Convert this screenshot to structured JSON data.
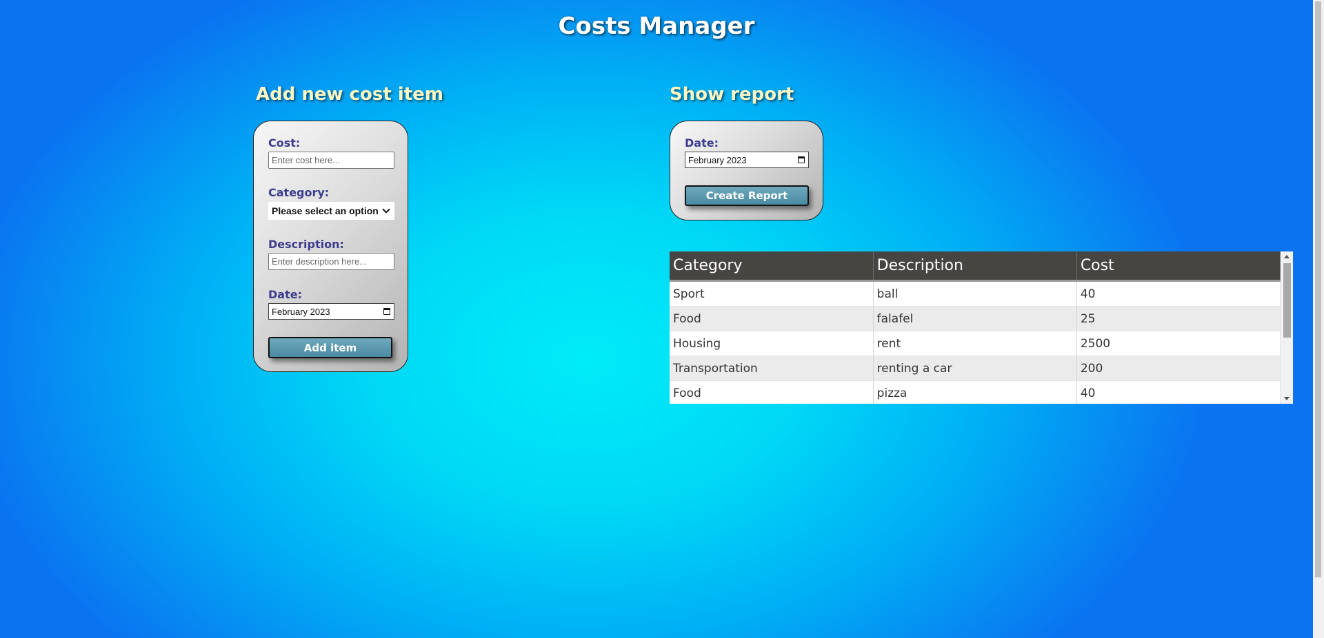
{
  "app": {
    "title": "Costs Manager"
  },
  "add_section": {
    "title": "Add new cost item",
    "cost": {
      "label": "Cost:",
      "placeholder": "Enter cost here..."
    },
    "category": {
      "label": "Category:",
      "selected": "Please select an option"
    },
    "description": {
      "label": "Description:",
      "placeholder": "Enter description here..."
    },
    "date": {
      "label": "Date:",
      "value": "February 2023",
      "icon": "calendar-icon"
    },
    "button": "Add item"
  },
  "report_section": {
    "title": "Show report",
    "date": {
      "label": "Date:",
      "value": "February 2023",
      "icon": "calendar-icon"
    },
    "button": "Create Report"
  },
  "table": {
    "headers": [
      "Category",
      "Description",
      "Cost"
    ],
    "rows": [
      {
        "category": "Sport",
        "description": "ball",
        "cost": "40"
      },
      {
        "category": "Food",
        "description": "falafel",
        "cost": "25"
      },
      {
        "category": "Housing",
        "description": "rent",
        "cost": "2500"
      },
      {
        "category": "Transportation",
        "description": "renting a car",
        "cost": "200"
      },
      {
        "category": "Food",
        "description": "pizza",
        "cost": "40"
      }
    ]
  },
  "colors": {
    "background": "#00d8f6",
    "section_title": "#fff8c2",
    "label": "#3e3c8e",
    "button": "#5b98ad",
    "table_header": "#464542"
  }
}
